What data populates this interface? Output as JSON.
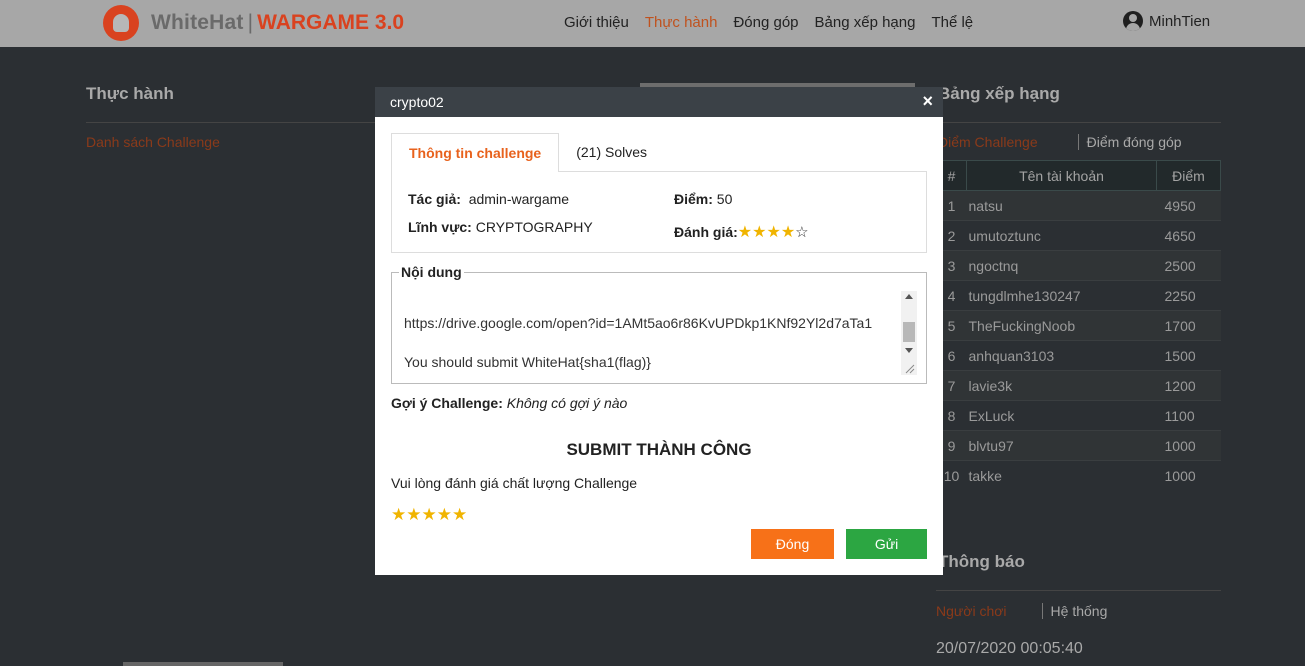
{
  "header": {
    "logo_text": "WhiteHat",
    "logo_sep": "|",
    "logo_game": "WARGAME 3.0",
    "nav": [
      "Giới thiệu",
      "Thực hành",
      "Đóng góp",
      "Bảng xếp hạng",
      "Thể lệ"
    ],
    "active_nav": "Thực hành",
    "username": "MinhTien"
  },
  "left": {
    "title": "Thực hành",
    "link": "Danh sách Challenge"
  },
  "ranking": {
    "title": "Bảng xếp hạng",
    "tabs": [
      "Điểm Challenge",
      "Điểm đóng góp"
    ],
    "headers": [
      "#",
      "Tên tài khoản",
      "Điểm"
    ],
    "rows": [
      {
        "rank": "1",
        "name": "natsu",
        "score": "4950"
      },
      {
        "rank": "2",
        "name": "umutoztunc",
        "score": "4650"
      },
      {
        "rank": "3",
        "name": "ngoctnq",
        "score": "2500"
      },
      {
        "rank": "4",
        "name": "tungdlmhe130247",
        "score": "2250"
      },
      {
        "rank": "5",
        "name": "TheFuckingNoob",
        "score": "1700"
      },
      {
        "rank": "6",
        "name": "anhquan3103",
        "score": "1500"
      },
      {
        "rank": "7",
        "name": "lavie3k",
        "score": "1200"
      },
      {
        "rank": "8",
        "name": "ExLuck",
        "score": "1100"
      },
      {
        "rank": "9",
        "name": "blvtu97",
        "score": "1000"
      },
      {
        "rank": "10",
        "name": "takke",
        "score": "1000"
      }
    ]
  },
  "notice": {
    "title": "Thông báo",
    "tabs": [
      "Người chơi",
      "Hệ thống"
    ],
    "date": "20/07/2020 00:05:40"
  },
  "modal": {
    "title": "crypto02",
    "close_symbol": "×",
    "tabs": [
      "Thông tin challenge",
      "(21) Solves"
    ],
    "author_label": "Tác giả:",
    "author": "admin-wargame",
    "field_label": "Lĩnh vực:",
    "field": "CRYPTOGRAPHY",
    "score_label": "Điểm:",
    "score": "50",
    "rating_label": "Đánh giá:",
    "rating": 4,
    "rating_max": 5,
    "content_label": "Nội dung",
    "content_line1": "https://drive.google.com/open?id=1AMt5ao6r86KvUPDkp1KNf92Yl2d7aTa1",
    "content_line2": "You should submit WhiteHat{sha1(flag)}",
    "hint_label": "Gợi ý Challenge:",
    "hint_value": "Không có gợi ý nào",
    "submit_title": "SUBMIT THÀNH CÔNG",
    "rate_prompt": "Vui lòng đánh giá chất lượng Challenge",
    "rate_stars": "★★★★★",
    "btn_close": "Đóng",
    "btn_send": "Gửi"
  },
  "colors": {
    "accent": "#e8621d",
    "close_button": "#f77118",
    "send_button": "#2ca642",
    "star": "#f0b400",
    "modal_header": "#3b4147"
  }
}
